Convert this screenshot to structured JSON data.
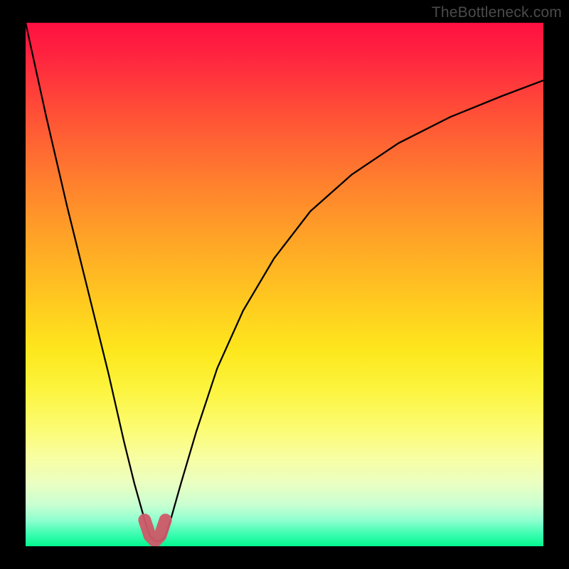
{
  "watermark": "TheBottleneck.com",
  "chart_data": {
    "type": "line",
    "title": "",
    "xlabel": "",
    "ylabel": "",
    "xlim": [
      0,
      100
    ],
    "ylim": [
      0,
      100
    ],
    "series": [
      {
        "name": "curve",
        "x": [
          0,
          4,
          8,
          12,
          16,
          19,
          21,
          23,
          24,
          25,
          26,
          27,
          28,
          30,
          33,
          37,
          42,
          48,
          55,
          63,
          72,
          82,
          92,
          100
        ],
        "y": [
          100,
          82,
          65,
          49,
          33,
          20,
          12,
          5,
          2,
          1,
          1,
          2,
          5,
          12,
          22,
          34,
          45,
          55,
          64,
          71,
          77,
          82,
          86,
          89
        ]
      },
      {
        "name": "minimum-highlight",
        "x": [
          23,
          24,
          25,
          26,
          27
        ],
        "y": [
          5,
          2,
          1,
          2,
          5
        ]
      }
    ],
    "gradient_stops": [
      {
        "pos": 0.0,
        "color": "#ff1041"
      },
      {
        "pos": 0.3,
        "color": "#ff7e2e"
      },
      {
        "pos": 0.63,
        "color": "#fde81e"
      },
      {
        "pos": 0.88,
        "color": "#eaffc2"
      },
      {
        "pos": 1.0,
        "color": "#03f890"
      }
    ]
  }
}
